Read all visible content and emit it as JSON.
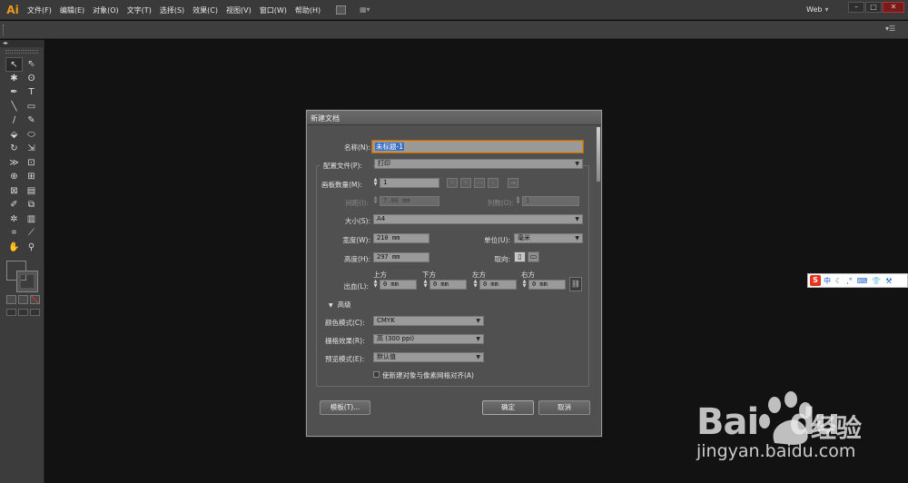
{
  "app": {
    "logo": "Ai"
  },
  "menu": [
    "文件(F)",
    "编辑(E)",
    "对象(O)",
    "文字(T)",
    "选择(S)",
    "效果(C)",
    "视图(V)",
    "窗口(W)",
    "帮助(H)"
  ],
  "workspace": "Web",
  "dialog": {
    "title": "新建文档",
    "name_label": "名称(N):",
    "name_value": "未标题-1",
    "profile_label": "配置文件(P):",
    "profile_value": "打印",
    "artboards_label": "画板数量(M):",
    "artboards_value": "1",
    "spacing_label": "间距(I):",
    "spacing_value": "7.06 mm",
    "columns_label": "列数(O):",
    "columns_value": "1",
    "size_label": "大小(S):",
    "size_value": "A4",
    "width_label": "宽度(W):",
    "width_value": "210 mm",
    "units_label": "单位(U):",
    "units_value": "毫米",
    "height_label": "高度(H):",
    "height_value": "297 mm",
    "orientation_label": "取向:",
    "bleed_label": "出血(L):",
    "bleed_top_label": "上方",
    "bleed_bottom_label": "下方",
    "bleed_left_label": "左方",
    "bleed_right_label": "右方",
    "bleed_top": "0 mm",
    "bleed_bottom": "0 mm",
    "bleed_left": "0 mm",
    "bleed_right": "0 mm",
    "advanced_label": "高级",
    "color_mode_label": "颜色模式(C):",
    "color_mode_value": "CMYK",
    "raster_label": "栅格效果(R):",
    "raster_value": "高 (300 ppi)",
    "preview_label": "预览模式(E):",
    "preview_value": "默认值",
    "pixel_grid_label": "使新建对象与像素网格对齐(A)",
    "templates_button": "模板(T)...",
    "ok_button": "确定",
    "cancel_button": "取消"
  },
  "ime": {
    "logo": "S",
    "lang": "中"
  },
  "watermark": {
    "brand": "Bai",
    "brand_suffix": "du",
    "product": "经验",
    "url": "jingyan.baidu.com"
  }
}
